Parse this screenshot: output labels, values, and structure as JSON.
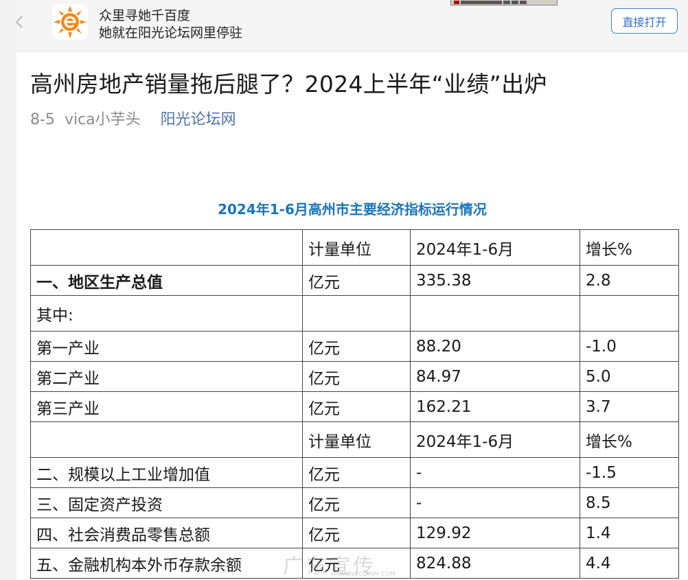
{
  "banner": {
    "line1": "众里寻她千百度",
    "line2": "她就在阳光论坛网里停驻",
    "open_label": "直接打开",
    "logo_icon": "sun-e-logo-icon",
    "logo_color": "#f28a1a"
  },
  "article": {
    "title": "高州房地产销量拖后腿了？2024上半年“业绩”出炉",
    "date": "8-5",
    "author": "vica小芋头",
    "forum": "阳光论坛网"
  },
  "table": {
    "caption": "2024年1-6月高州市主要经济指标运行情况",
    "rows": [
      {
        "name": "",
        "unit": "计量单位",
        "value": "2024年1-6月",
        "growth": "增长%"
      },
      {
        "name": "一、地区生产总值",
        "unit": "亿元",
        "value": "335.38",
        "growth": "2.8"
      },
      {
        "name": "其中:",
        "unit": "",
        "value": "",
        "growth": ""
      },
      {
        "name": "第一产业",
        "unit": "亿元",
        "value": "88.20",
        "growth": "-1.0"
      },
      {
        "name": "第二产业",
        "unit": "亿元",
        "value": "84.97",
        "growth": "5.0"
      },
      {
        "name": "第三产业",
        "unit": "亿元",
        "value": "162.21",
        "growth": "3.7"
      },
      {
        "name": "",
        "unit": "计量单位",
        "value": "2024年1-6月",
        "growth": "增长%"
      },
      {
        "name": "二、规模以上工业增加值",
        "unit": "亿元",
        "value": "-",
        "growth": "-1.5"
      },
      {
        "name": "三、固定资产投资",
        "unit": "亿元",
        "value": "-",
        "growth": "8.5"
      },
      {
        "name": "四、社会消费品零售总额",
        "unit": "亿元",
        "value": "129.92",
        "growth": "1.4"
      },
      {
        "name": "五、金融机构本外币存款余额",
        "unit": "亿元",
        "value": "824.88",
        "growth": "4.4"
      }
    ]
  },
  "watermark": {
    "text": "广东宣传",
    "url": "WWW.GDMM.COM"
  }
}
